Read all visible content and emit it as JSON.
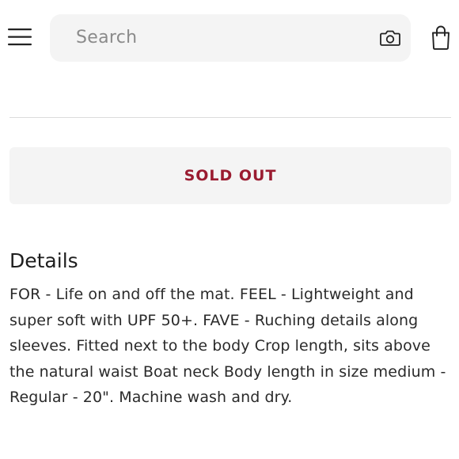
{
  "header": {
    "menu_icon": "hamburger-menu-icon",
    "search": {
      "placeholder": "Search",
      "camera_icon": "camera-icon"
    },
    "bag_icon": "shopping-bag-icon"
  },
  "purchase": {
    "status_label": "SOLD OUT",
    "status_color": "#9a1b30"
  },
  "details": {
    "title": "Details",
    "body": "FOR - Life on and off the mat. FEEL - Lightweight and super soft with UPF 50+. FAVE - Ruching details along sleeves. Fitted next to the body Crop length, sits above the natural waist Boat neck Body length in size medium - Regular - 20\". Machine wash and dry."
  }
}
